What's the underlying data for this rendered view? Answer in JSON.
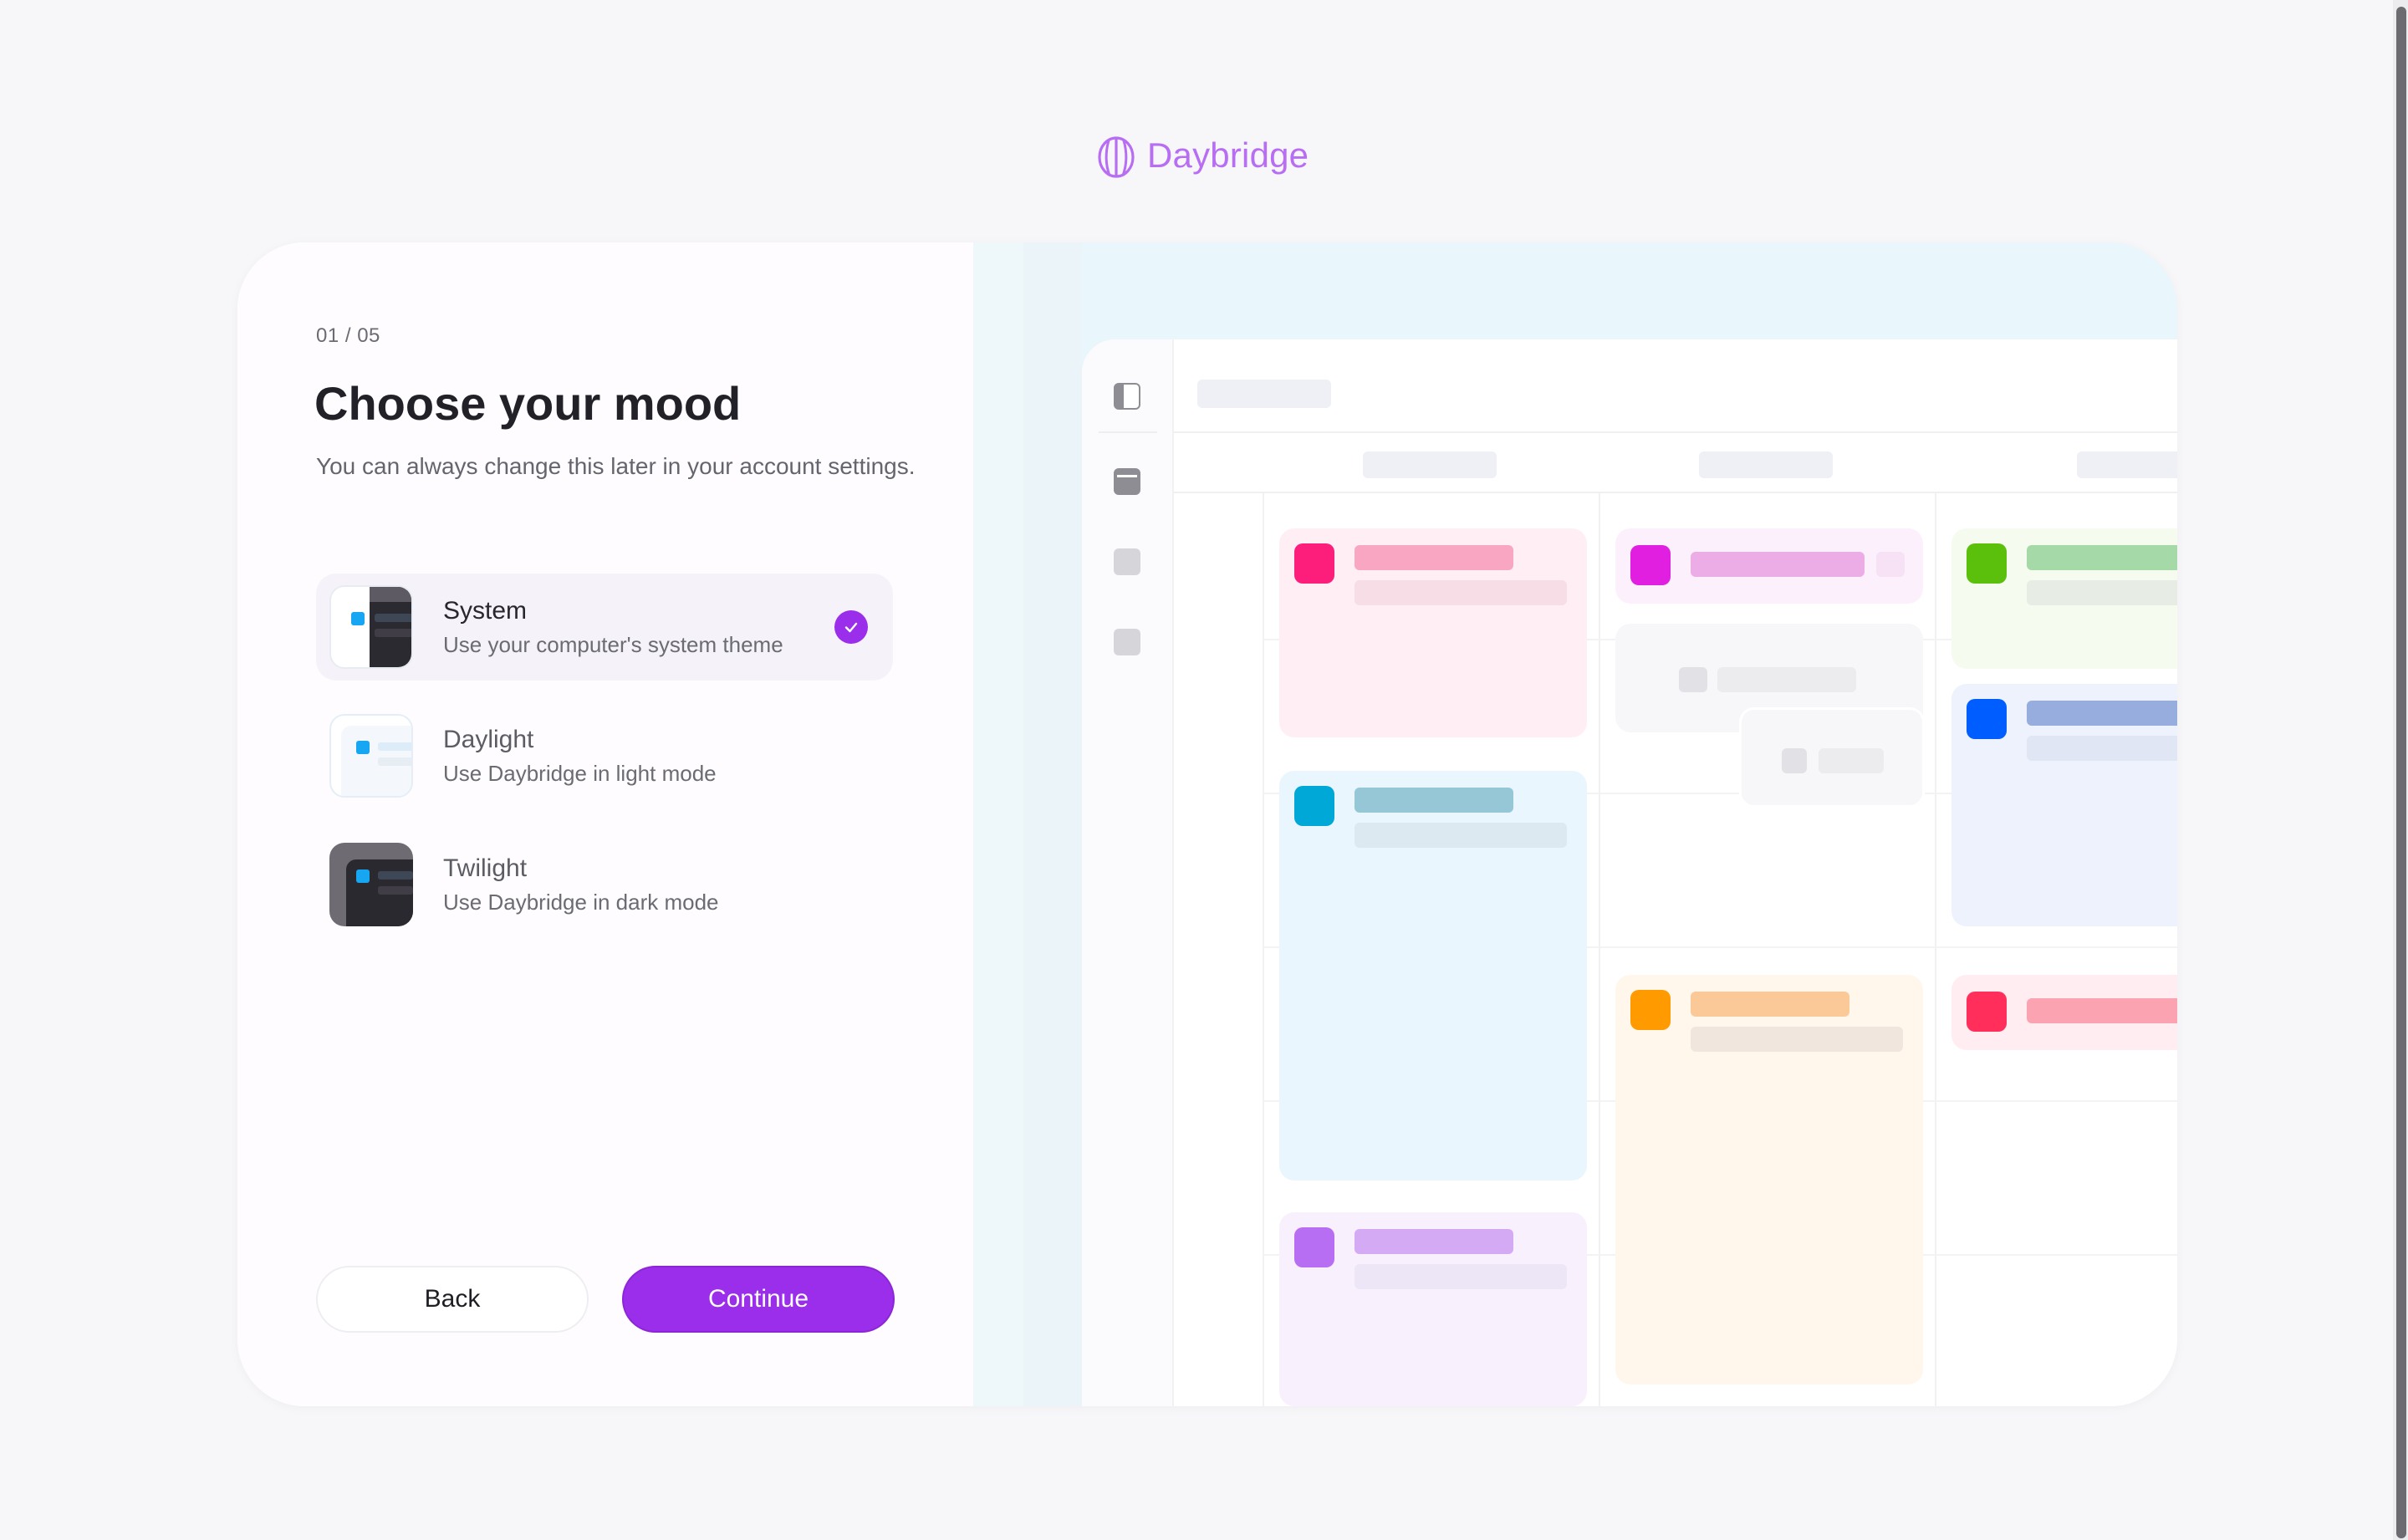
{
  "brand": {
    "name": "Daybridge",
    "color": "#b86ef2"
  },
  "onboarding": {
    "step": "01 / 05",
    "title": "Choose your mood",
    "subtitle": "You can always change this later in your account settings."
  },
  "theme_options": [
    {
      "name": "System",
      "description": "Use your computer's system theme",
      "selected": true,
      "icon": "system-theme-icon"
    },
    {
      "name": "Daylight",
      "description": "Use Daybridge in light mode",
      "selected": false,
      "icon": "light-theme-icon"
    },
    {
      "name": "Twilight",
      "description": "Use Daybridge in dark mode",
      "selected": false,
      "icon": "dark-theme-icon"
    }
  ],
  "buttons": {
    "back": "Back",
    "continue": "Continue"
  },
  "colors": {
    "accent": "#9a2eea",
    "event_pink": "#fd1e7b",
    "event_magenta": "#e01fe0",
    "event_green": "#5bc00c",
    "event_blue": "#005dff",
    "event_cyan": "#00a8d8",
    "event_orange": "#ff9a00",
    "event_red": "#ff2e5a",
    "event_purple": "#b86ef2"
  },
  "preview": {
    "sidebar_icons": [
      "panel-toggle-icon",
      "calendar-icon",
      "placeholder-icon",
      "placeholder-icon"
    ]
  }
}
